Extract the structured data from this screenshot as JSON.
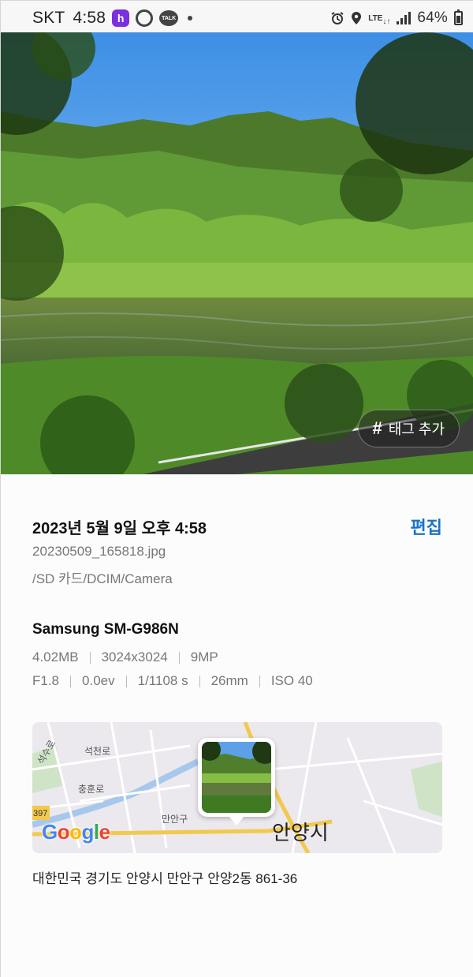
{
  "status_bar": {
    "carrier": "SKT",
    "time": "4:58",
    "apps": [
      "purple-h-app-icon",
      "ring-app-icon",
      "talk-app-icon"
    ],
    "talk_label": "TALK",
    "network": "LTE",
    "battery": "64%"
  },
  "photo": {
    "tag_button": "태그 추가",
    "tag_symbol": "#"
  },
  "details": {
    "datetime": "2023년 5월 9일 오후 4:58",
    "edit_label": "편집",
    "filename": "20230509_165818.jpg",
    "path": "/SD 카드/DCIM/Camera",
    "device": "Samsung SM-G986N",
    "file_info": [
      "4.02MB",
      "3024x3024",
      "9MP"
    ],
    "camera_info": [
      "F1.8",
      "0.0ev",
      "1/1108 s",
      "26mm",
      "ISO 40"
    ]
  },
  "map": {
    "labels": [
      "석천로",
      "충훈로",
      "만안구",
      "석수로"
    ],
    "city": "안양시",
    "road_number": "397",
    "logo": "Google"
  },
  "address": "대한민국 경기도 안양시 만안구 안양2동 861-36",
  "colors": {
    "accent": "#1a73c8",
    "secondary_text": "#777777",
    "app_h": "#7a2fe0"
  }
}
